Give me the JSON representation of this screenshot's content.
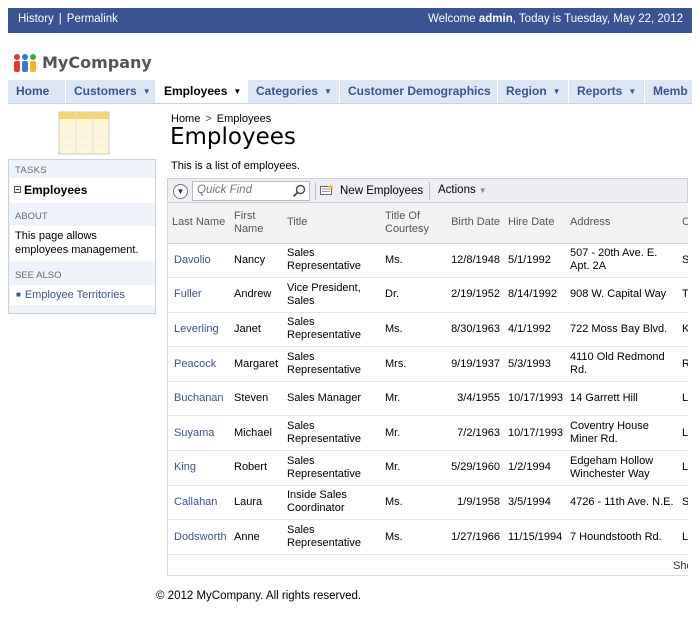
{
  "topbar": {
    "history": "History",
    "separator": "|",
    "permalink": "Permalink",
    "welcome_prefix": "Welcome",
    "user": "admin",
    "date_text": ", Today is Tuesday, May 22, 2012"
  },
  "app": {
    "name": "MyCompany"
  },
  "nav": {
    "tabs": [
      {
        "label": "Home",
        "dropdown": false
      },
      {
        "label": "Customers",
        "dropdown": true
      },
      {
        "label": "Employees",
        "dropdown": true,
        "active": true
      },
      {
        "label": "Categories",
        "dropdown": true
      },
      {
        "label": "Customer Demographics",
        "dropdown": false
      },
      {
        "label": "Region",
        "dropdown": true
      },
      {
        "label": "Reports",
        "dropdown": true
      },
      {
        "label": "Memb",
        "dropdown": false
      }
    ]
  },
  "sidebar": {
    "tasks_title": "TASKS",
    "task_item": "Employees",
    "about_title": "ABOUT",
    "about_text": "This page allows employees management.",
    "see_also_title": "SEE ALSO",
    "see_also_link": "Employee Territories"
  },
  "breadcrumb": {
    "home": "Home",
    "separator": ">",
    "current": "Employees"
  },
  "page": {
    "title": "Employees",
    "description": "This is a list of employees."
  },
  "toolbar": {
    "quick_find_placeholder": "Quick Find",
    "new_label": "New Employees",
    "actions_label": "Actions"
  },
  "grid": {
    "columns": [
      "Last Name",
      "First Name",
      "Title",
      "Title Of Courtesy",
      "Birth Date",
      "Hire Date",
      "Address",
      "C"
    ],
    "rows": [
      [
        "Davolio",
        "Nancy",
        "Sales Representative",
        "Ms.",
        "12/8/1948",
        "5/1/1992",
        "507 - 20th Ave. E. Apt. 2A",
        "S"
      ],
      [
        "Fuller",
        "Andrew",
        "Vice President, Sales",
        "Dr.",
        "2/19/1952",
        "8/14/1992",
        "908 W. Capital Way",
        "T"
      ],
      [
        "Leverling",
        "Janet",
        "Sales Representative",
        "Ms.",
        "8/30/1963",
        "4/1/1992",
        "722 Moss Bay Blvd.",
        "K"
      ],
      [
        "Peacock",
        "Margaret",
        "Sales Representative",
        "Mrs.",
        "9/19/1937",
        "5/3/1993",
        "4110 Old Redmond Rd.",
        "R"
      ],
      [
        "Buchanan",
        "Steven",
        "Sales Manager",
        "Mr.",
        "3/4/1955",
        "10/17/1993",
        "14 Garrett Hill",
        "L"
      ],
      [
        "Suyama",
        "Michael",
        "Sales Representative",
        "Mr.",
        "7/2/1963",
        "10/17/1993",
        "Coventry House Miner Rd.",
        "L"
      ],
      [
        "King",
        "Robert",
        "Sales Representative",
        "Mr.",
        "5/29/1960",
        "1/2/1994",
        "Edgeham Hollow Winchester Way",
        "L"
      ],
      [
        "Callahan",
        "Laura",
        "Inside Sales Coordinator",
        "Ms.",
        "1/9/1958",
        "3/5/1994",
        "4726 - 11th Ave. N.E.",
        "S"
      ],
      [
        "Dodsworth",
        "Anne",
        "Sales Representative",
        "Ms.",
        "1/27/1966",
        "11/15/1994",
        "7 Houndstooth Rd.",
        "L"
      ]
    ],
    "pager_text": "Sho"
  },
  "footer": {
    "text": "© 2012 MyCompany. All rights reserved."
  },
  "colors": {
    "topbar_bg": "#3a5393",
    "nav_bg": "#dde6f3",
    "link": "#3a5393",
    "panel_bg": "#eef2f9"
  },
  "icons": {
    "logo": "people-logo-icon",
    "graphic": "table-view-icon",
    "search": "search-icon",
    "new": "new-record-icon",
    "toggle": "chevron-down-icon"
  }
}
